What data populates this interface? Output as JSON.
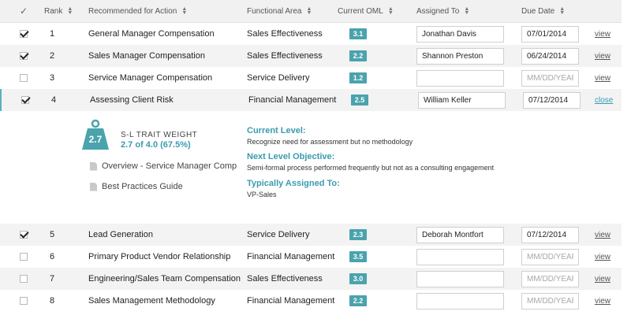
{
  "header": {
    "rank": "Rank",
    "action": "Recommended for Action",
    "area": "Functional Area",
    "oml": "Current OML",
    "assigned": "Assigned To",
    "due": "Due Date"
  },
  "rows": [
    {
      "checked": true,
      "rank": "1",
      "action": "General Manager Compensation",
      "area": "Sales Effectiveness",
      "oml": "3.1",
      "assigned": "Jonathan Davis",
      "due": "07/01/2014",
      "link": "view"
    },
    {
      "checked": true,
      "rank": "2",
      "action": "Sales Manager Compensation",
      "area": "Sales Effectiveness",
      "oml": "2.2",
      "assigned": "Shannon Preston",
      "due": "06/24/2014",
      "link": "view"
    },
    {
      "checked": false,
      "rank": "3",
      "action": "Service Manager Compensation",
      "area": "Service Delivery",
      "oml": "1.2",
      "assigned": "",
      "due": "",
      "link": "view"
    },
    {
      "checked": true,
      "rank": "4",
      "action": "Assessing Client Risk",
      "area": "Financial Management",
      "oml": "2.5",
      "assigned": "William Keller",
      "due": "07/12/2014",
      "link": "close"
    },
    {
      "checked": true,
      "rank": "5",
      "action": "Lead Generation",
      "area": "Service Delivery",
      "oml": "2.3",
      "assigned": "Deborah Montfort",
      "due": "07/12/2014",
      "link": "view"
    },
    {
      "checked": false,
      "rank": "6",
      "action": "Primary Product  Vendor Relationship",
      "area": "Financial Management",
      "oml": "3.5",
      "assigned": "",
      "due": "",
      "link": "view"
    },
    {
      "checked": false,
      "rank": "7",
      "action": "Engineering/Sales Team Compensation",
      "area": "Sales Effectiveness",
      "oml": "3.0",
      "assigned": "",
      "due": "",
      "link": "view"
    },
    {
      "checked": false,
      "rank": "8",
      "action": "Sales Management Methodology",
      "area": "Financial Management",
      "oml": "2.2",
      "assigned": "",
      "due": "",
      "link": "view"
    }
  ],
  "due_placeholder": "MM/DD/YEAR",
  "detail": {
    "weight": "2.7",
    "trait_title": "S-L TRAIT WEIGHT",
    "trait_value": "2.7 of 4.0 (67.5%)",
    "docs": [
      "Overview - Service Manager Comp",
      "Best Practices Guide"
    ],
    "current_level_title": "Current Level:",
    "current_level_text": "Recognize need for assessment but no methodology",
    "next_level_title": "Next Level Objective:",
    "next_level_text": "Semi-formal process performed frequently but not as a consulting engagement",
    "assigned_title": "Typically Assigned To:",
    "assigned_text": "VP-Sales"
  },
  "colors": {
    "accent": "#4aa3ad",
    "link_active": "#3a9bb0"
  }
}
